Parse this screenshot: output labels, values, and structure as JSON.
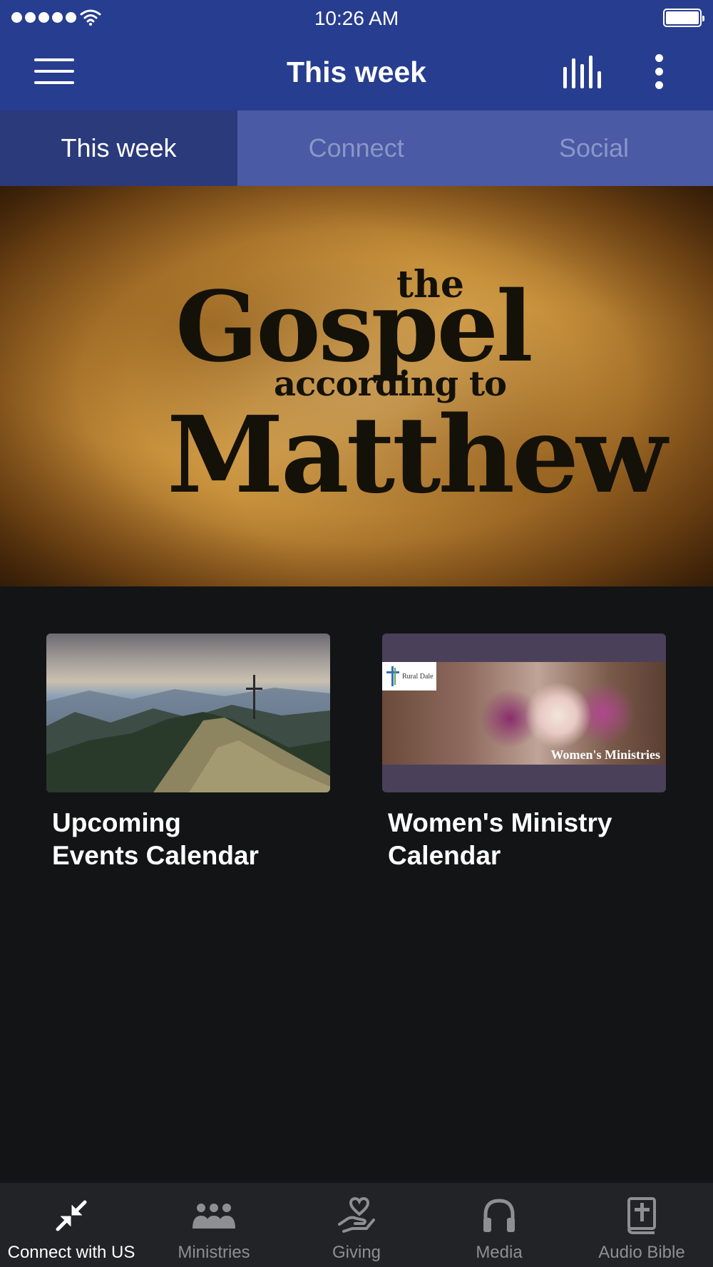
{
  "status_bar": {
    "time": "10:26 AM",
    "signal_icon": "signal-dots-icon",
    "wifi_icon": "wifi-icon",
    "battery_icon": "battery-icon"
  },
  "header": {
    "title": "This week",
    "menu_icon": "hamburger-menu-icon",
    "stats_icon": "audio-bars-icon",
    "more_icon": "more-vertical-icon"
  },
  "tabs": [
    {
      "label": "This week",
      "active": true
    },
    {
      "label": "Connect",
      "active": false
    },
    {
      "label": "Social",
      "active": false
    }
  ],
  "hero": {
    "the": "the",
    "gospel": "Gospel",
    "according": "according to",
    "matthew": "Matthew"
  },
  "cards": [
    {
      "title": "Upcoming\nEvents Calendar",
      "image": "mountain-cross-image"
    },
    {
      "title": "Women's Ministry\nCalendar",
      "image": "flowers-in-hands-image",
      "logo_text": "Rural Dale",
      "banner_text": "Women's Ministries"
    }
  ],
  "bottom_nav": [
    {
      "label": "Connect with US",
      "icon": "collapse-arrows-icon",
      "active": true
    },
    {
      "label": "Ministries",
      "icon": "people-group-icon",
      "active": false
    },
    {
      "label": "Giving",
      "icon": "heart-hand-icon",
      "active": false
    },
    {
      "label": "Media",
      "icon": "headphones-icon",
      "active": false
    },
    {
      "label": "Audio Bible",
      "icon": "bible-icon",
      "active": false
    }
  ],
  "colors": {
    "header_bg": "#273d8f",
    "tab_bg": "#4a5aa5",
    "tab_active_bg": "#2b3a7b",
    "page_bg": "#131416",
    "nav_bg": "#222326"
  }
}
